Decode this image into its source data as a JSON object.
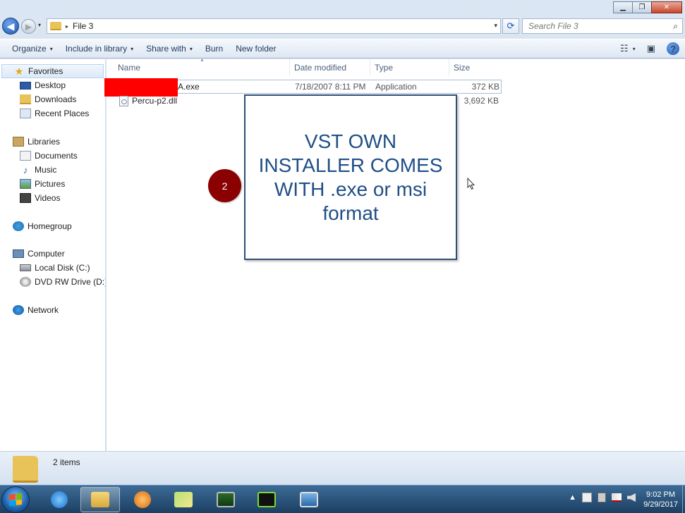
{
  "window": {
    "minimize": "▁",
    "maximize": "❐",
    "close": "✕"
  },
  "navbar": {
    "back_glyph": "◀",
    "forward_glyph": "▶",
    "history_glyph": "▾",
    "breadcrumb_sep": "▸",
    "path": "File 3",
    "dropdown_glyph": "▾",
    "refresh_glyph": "⟳",
    "search_placeholder": "Search File 3",
    "search_glyph": "⌕"
  },
  "toolbar": {
    "organize": "Organize",
    "include_in_library": "Include in library",
    "share_with": "Share with",
    "burn": "Burn",
    "new_folder": "New folder",
    "caret": "▾",
    "views_glyph": "☷",
    "views_caret": "▾",
    "preview_glyph": "▣",
    "help_glyph": "?"
  },
  "nav": {
    "favorites": "Favorites",
    "desktop": "Desktop",
    "downloads": "Downloads",
    "recent_places": "Recent Places",
    "libraries": "Libraries",
    "documents": "Documents",
    "music": "Music",
    "pictures": "Pictures",
    "videos": "Videos",
    "homegroup": "Homegroup",
    "computer": "Computer",
    "local_disk": "Local Disk (C:)",
    "dvd_drive": "DVD RW Drive (D:) M",
    "network": "Network",
    "star_glyph": "★",
    "note_glyph": "♪"
  },
  "columns": {
    "name": "Name",
    "date_modified": "Date modified",
    "type": "Type",
    "size": "Size",
    "sort_glyph": "▲"
  },
  "files": [
    {
      "name": "A.exe",
      "date": "7/18/2007 8:11 PM",
      "type": "Application",
      "size": "372 KB"
    },
    {
      "name": "Percu-p2.dll",
      "date": "",
      "type": "",
      "size": "3,692 KB"
    }
  ],
  "callout": {
    "text": "VST OWN INSTALLER COMES WITH .exe or msi format",
    "badge": "2"
  },
  "details": {
    "count": "2 items"
  },
  "taskbar": {
    "tray_arrow": "▲",
    "time": "9:02 PM",
    "date": "9/29/2017"
  },
  "colors": {
    "callout_text": "#1f4e86",
    "badge": "#8b0000",
    "redaction": "#ff0000"
  }
}
